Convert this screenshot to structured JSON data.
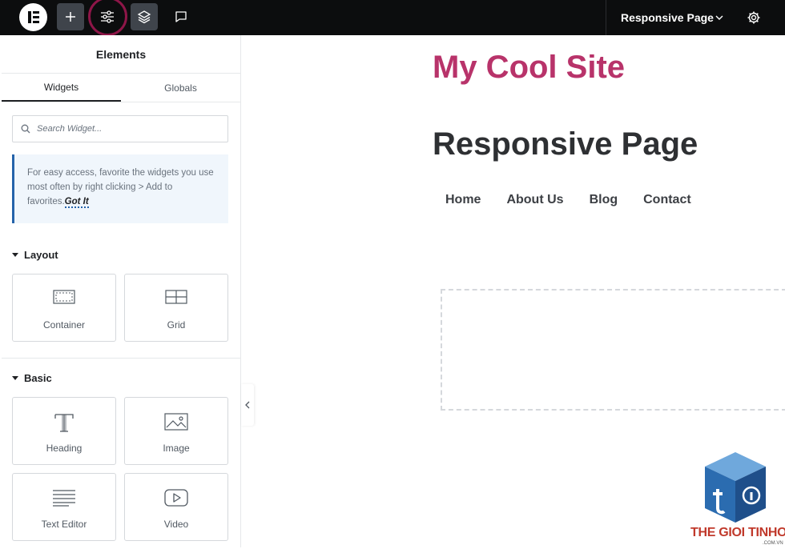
{
  "topbar": {
    "logo": "elementor-logo",
    "buttons": [
      {
        "name": "add-icon"
      },
      {
        "name": "site-settings-icon",
        "highlighted": true
      },
      {
        "name": "structure-layers-icon"
      },
      {
        "name": "notes-comment-icon"
      }
    ],
    "page_selector": "Responsive Page",
    "settings_icon": "gear-icon",
    "highlight_color": "#8e1648"
  },
  "panel": {
    "title": "Elements",
    "tabs": [
      {
        "label": "Widgets",
        "active": true
      },
      {
        "label": "Globals",
        "active": false
      }
    ],
    "search_placeholder": "Search Widget...",
    "notice": {
      "text": "For easy access, favorite the widgets you use most often by right clicking > Add to favorites.",
      "link": "Got It"
    },
    "sections": [
      {
        "title": "Layout",
        "widgets": [
          {
            "label": "Container",
            "icon": "container-icon"
          },
          {
            "label": "Grid",
            "icon": "grid-icon"
          }
        ]
      },
      {
        "title": "Basic",
        "widgets": [
          {
            "label": "Heading",
            "icon": "heading-icon"
          },
          {
            "label": "Image",
            "icon": "image-icon"
          },
          {
            "label": "Text Editor",
            "icon": "text-editor-icon"
          },
          {
            "label": "Video",
            "icon": "video-icon"
          }
        ]
      }
    ]
  },
  "canvas": {
    "site_title": "My Cool Site",
    "page_title": "Responsive Page",
    "nav": [
      "Home",
      "About Us",
      "Blog",
      "Contact"
    ],
    "colors": {
      "site_title": "#b8336a",
      "page_title": "#2e3033"
    }
  },
  "watermark": {
    "text": "THE GIOI TINHOC",
    "sub": ".COM.VN"
  }
}
